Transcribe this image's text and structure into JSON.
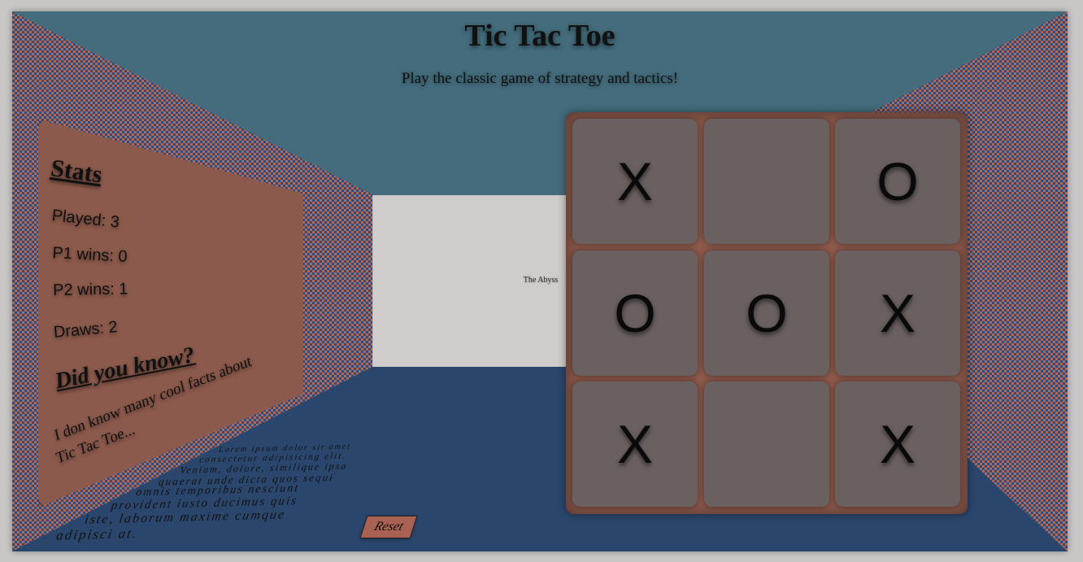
{
  "header": {
    "title": "Tic Tac Toe",
    "subtitle": "Play the classic game of strategy and tactics!"
  },
  "back_wall": {
    "label": "The Abyss"
  },
  "stats": {
    "heading": "Stats",
    "played": "Played: 3",
    "p1_wins": "P1 wins: 0",
    "p2_wins": "P2 wins: 1",
    "draws": "Draws: 2",
    "fact_heading": "Did you know?",
    "fact_line1": "I don know many cool facts about",
    "fact_line2": "Tic Tac Toe..."
  },
  "floor_text": [
    "Lorem ipsum dolor sit amet",
    "consectetur adipisicing elit.",
    "Veniam, dolore, similique ipsa",
    "quaerat unde dicta quos sequi",
    "omnis temporibus nesciunt",
    "provident iusto ducimus quis",
    "iste, laborum maxime cumque",
    "adipisci at."
  ],
  "controls": {
    "reset_label": "Reset"
  },
  "board": {
    "cells": [
      "X",
      "",
      "O",
      "O",
      "O",
      "X",
      "X",
      "",
      "X"
    ]
  },
  "colors": {
    "wall_blue": "#446c7c",
    "floor_blue": "#2b466c",
    "panel_brown": "#8c5a4c",
    "cell_gray": "#6a6060",
    "back_wall": "#cfcccb"
  }
}
